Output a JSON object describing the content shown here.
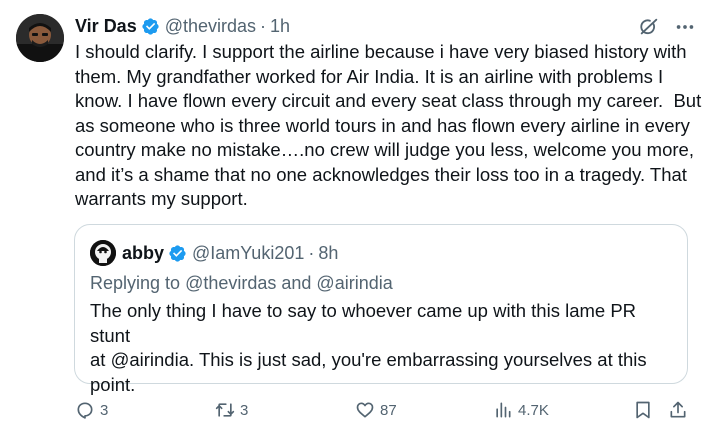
{
  "author": {
    "display_name": "Vir Das",
    "handle": "@thevirdas",
    "separator": "·",
    "time": "1h"
  },
  "tweet": {
    "text": "I should clarify. I support the airline because i have very biased history with\nthem. My grandfather worked for Air India. It is an airline with problems I\nknow. I have flown every circuit and every seat class through my career.  But\nas someone who is three world tours in and has flown every airline in every\ncountry make no mistake….no crew will judge you less, welcome you more,\nand it’s a shame that no one acknowledges their loss too in a tragedy. That\nwarrants my support."
  },
  "quote": {
    "display_name": "abby",
    "handle": "@IamYuki201",
    "separator": "·",
    "time": "8h",
    "replying_prefix": "Replying to ",
    "replying_user1": "@thevirdas",
    "replying_and": " and ",
    "replying_user2": "@airindia",
    "text": "The only thing I have to say to whoever came up with this lame PR stunt\nat @airindia. This is just sad, you're embarrassing yourselves at this\npoint."
  },
  "actions": {
    "replies": "3",
    "reposts": "3",
    "likes": "87",
    "views": "4.7K"
  },
  "icons": {
    "verified": "verified-badge-icon",
    "grok": "grok-icon",
    "more": "more-icon",
    "reply": "reply-icon",
    "repost": "repost-icon",
    "like": "heart-icon",
    "views": "views-icon",
    "bookmark": "bookmark-icon",
    "share": "share-icon"
  },
  "colors": {
    "verified": "#1d9bf0",
    "secondary_text": "#536471",
    "primary_text": "#0f1419",
    "border": "#cfd9de"
  }
}
